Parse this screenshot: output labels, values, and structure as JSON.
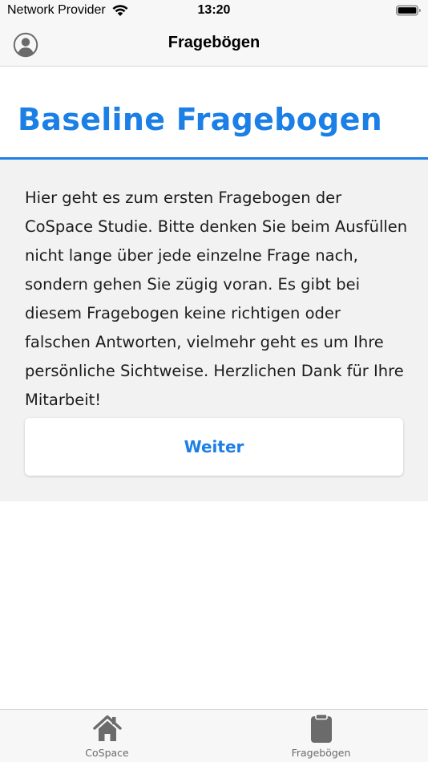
{
  "status_bar": {
    "carrier": "Network Provider",
    "time": "13:20"
  },
  "nav": {
    "title": "Fragebögen",
    "profile_icon": "person-circle-icon"
  },
  "page": {
    "heading": "Baseline Fragebogen",
    "intro_text": "Hier geht es zum ersten Fragebogen der CoSpace Studie. Bitte denken Sie beim Ausfüllen nicht lange über jede einzelne Frage nach, sondern gehen Sie zügig voran. Es gibt bei diesem Fragebogen keine richtigen oder falschen Antworten, vielmehr geht es um Ihre persönliche Sichtweise. Herzlichen Dank für Ihre Mitarbeit!",
    "continue_label": "Weiter"
  },
  "tab_bar": {
    "tabs": [
      {
        "label": "CoSpace",
        "icon": "house-icon"
      },
      {
        "label": "Fragebögen",
        "icon": "clipboard-icon"
      }
    ]
  },
  "colors": {
    "accent": "#1b7fe6",
    "content_bg": "#f2f2f2",
    "bar_bg": "#f7f7f7",
    "icon_gray": "#6b6b6b"
  }
}
